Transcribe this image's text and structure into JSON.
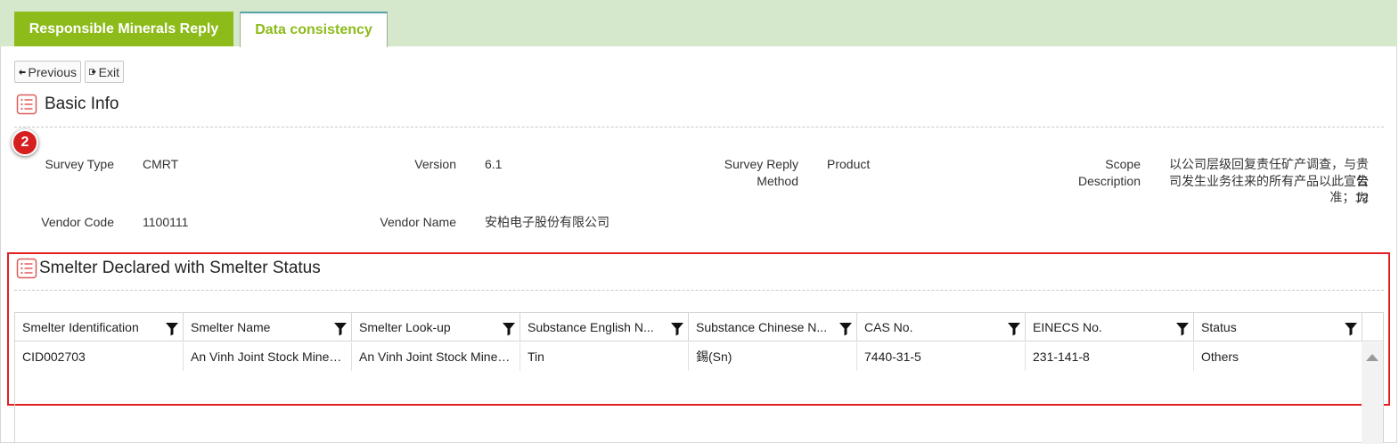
{
  "tabs": [
    {
      "label": "Responsible Minerals Reply",
      "active": false
    },
    {
      "label": "Data consistency",
      "active": true
    }
  ],
  "toolbar": {
    "previous_label": "Previous",
    "exit_label": "Exit"
  },
  "basic_info": {
    "title": "Basic Info",
    "step_badge": "2",
    "fields": {
      "survey_type_label": "Survey Type",
      "survey_type_value": "CMRT",
      "version_label": "Version",
      "version_value": "6.1",
      "reply_method_label_1": "Survey Reply",
      "reply_method_label_2": "Method",
      "reply_method_value": "Product",
      "scope_label_1": "Scope",
      "scope_label_2": "Description",
      "scope_value_1": "以公司层级回复责任矿产调查，与贵公",
      "scope_value_2": "司发生业务往来的所有产品以此宣告为",
      "scope_value_3": "准；12",
      "vendor_code_label": "Vendor Code",
      "vendor_code_value": "1100111",
      "vendor_name_label": "Vendor Name",
      "vendor_name_value": "安柏电子股份有限公司"
    }
  },
  "smelter_section": {
    "title": "Smelter Declared with Smelter Status",
    "columns": [
      "Smelter Identification",
      "Smelter Name",
      "Smelter Look-up",
      "Substance English N...",
      "Substance Chinese N...",
      "CAS No.",
      "EINECS No.",
      "Status"
    ],
    "rows": [
      [
        "CID002703",
        "An Vinh Joint Stock Minera...",
        "An Vinh Joint Stock Minera...",
        "Tin",
        "錫(Sn)",
        "7440-31-5",
        "231-141-8",
        "Others"
      ]
    ]
  },
  "colors": {
    "tab_bar_bg": "#d6e8cc",
    "accent_green": "#8cbb1a",
    "highlight_red": "#e02020"
  }
}
